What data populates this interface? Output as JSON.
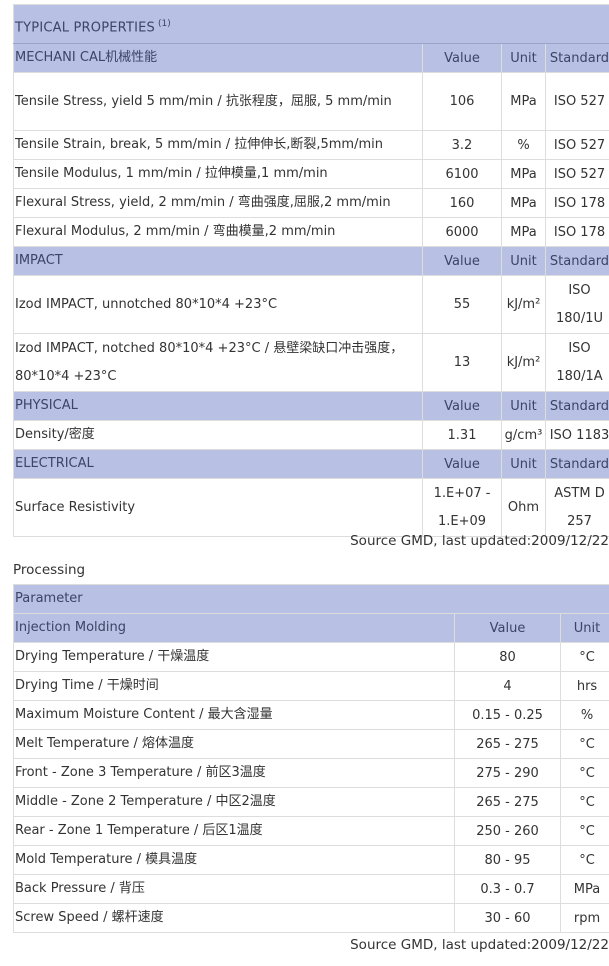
{
  "properties": {
    "title": "TYPICAL PROPERTIES",
    "title_ref": "(1)",
    "sections": [
      {
        "name": "MECHANI CAL机械性能",
        "col_value": "Value",
        "col_unit": "Unit",
        "col_standard": "Standard",
        "rows": [
          {
            "label": "Tensile Stress, yield 5 mm/min / 抗张程度，屈服, 5 mm/min",
            "value": "106",
            "unit": "MPa",
            "standard": "ISO 527"
          },
          {
            "label": "Tensile Strain, break, 5 mm/min / 拉伸伸长,断裂,5mm/min",
            "value": "3.2",
            "unit": "%",
            "standard": "ISO 527"
          },
          {
            "label": "Tensile Modulus, 1 mm/min / 拉伸模量,1 mm/min",
            "value": "6100",
            "unit": "MPa",
            "standard": "ISO 527"
          },
          {
            "label": "Flexural Stress, yield, 2 mm/min / 弯曲强度,屈服,2 mm/min",
            "value": "160",
            "unit": "MPa",
            "standard": "ISO 178"
          },
          {
            "label": "Flexural Modulus, 2 mm/min / 弯曲模量,2 mm/min",
            "value": "6000",
            "unit": "MPa",
            "standard": "ISO 178"
          }
        ]
      },
      {
        "name": "IMPACT",
        "col_value": "Value",
        "col_unit": "Unit",
        "col_standard": "Standard",
        "rows": [
          {
            "label": "Izod IMPACT, unnotched 80*10*4 +23°C",
            "value": "55",
            "unit": "kJ/m²",
            "standard": "ISO 180/1U"
          },
          {
            "label": "Izod IMPACT, notched 80*10*4 +23°C / 悬壁梁缺口冲击强度，80*10*4 +23°C",
            "value": "13",
            "unit": "kJ/m²",
            "standard": "ISO 180/1A"
          }
        ]
      },
      {
        "name": "PHYSICAL",
        "col_value": "Value",
        "col_unit": "Unit",
        "col_standard": "Standard",
        "rows": [
          {
            "label": "Density/密度",
            "value": "1.31",
            "unit": "g/cm³",
            "standard": "ISO 1183"
          }
        ]
      },
      {
        "name": "ELECTRICAL",
        "col_value": "Value",
        "col_unit": "Unit",
        "col_standard": "Standard",
        "rows": [
          {
            "label": "Surface Resistivity",
            "value": "1.E+07 - 1.E+09",
            "unit": "Ohm",
            "standard": "ASTM D 257"
          }
        ]
      }
    ],
    "source": "Source GMD, last updated:2009/12/22"
  },
  "processing": {
    "label": "Processing",
    "header": "Parameter",
    "section": "Injection Molding",
    "col_value": "Value",
    "col_unit": "Unit",
    "rows": [
      {
        "label": "Drying Temperature / 干燥温度",
        "value": "80",
        "unit": "°C"
      },
      {
        "label": "Drying Time / 干燥时间",
        "value": "4",
        "unit": "hrs"
      },
      {
        "label": "Maximum Moisture Content / 最大含湿量",
        "value": "0.15 - 0.25",
        "unit": "%"
      },
      {
        "label": "Melt Temperature / 熔体温度",
        "value": "265 - 275",
        "unit": "°C"
      },
      {
        "label": "Front - Zone 3 Temperature / 前区3温度",
        "value": "275 - 290",
        "unit": "°C"
      },
      {
        "label": "Middle - Zone 2 Temperature / 中区2温度",
        "value": "265 - 275",
        "unit": "°C"
      },
      {
        "label": "Rear - Zone 1 Temperature / 后区1温度",
        "value": "250 - 260",
        "unit": "°C"
      },
      {
        "label": "Mold Temperature / 模具温度",
        "value": "80 - 95",
        "unit": "°C"
      },
      {
        "label": "Back Pressure / 背压",
        "value": "0.3 - 0.7",
        "unit": "MPa"
      },
      {
        "label": "Screw Speed / 螺杆速度",
        "value": "30 - 60",
        "unit": "rpm"
      }
    ],
    "source": "Source GMD, last updated:2009/12/22"
  }
}
